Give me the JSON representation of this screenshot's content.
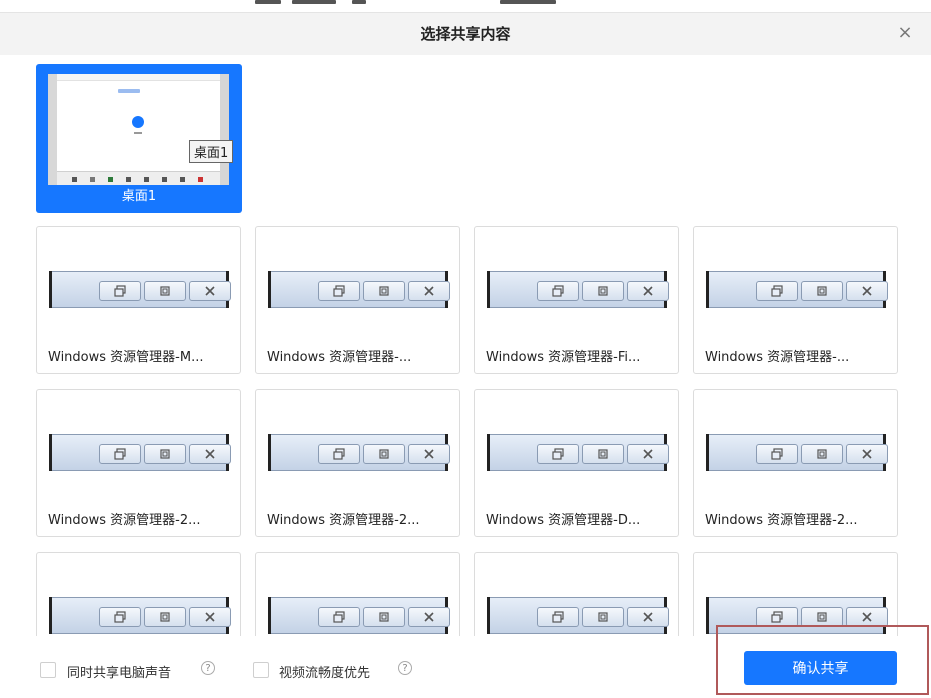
{
  "dialog": {
    "title": "选择共享内容",
    "close_glyph": "×"
  },
  "desktop": {
    "label": "桌面1",
    "tooltip": "桌面1",
    "selected": true,
    "accent_color": "#1677ff"
  },
  "windows": [
    {
      "label": "Windows 资源管理器-M..."
    },
    {
      "label": "Windows 资源管理器-..."
    },
    {
      "label": "Windows 资源管理器-Fi..."
    },
    {
      "label": "Windows 资源管理器-..."
    },
    {
      "label": "Windows 资源管理器-2..."
    },
    {
      "label": "Windows 资源管理器-2..."
    },
    {
      "label": "Windows 资源管理器-D..."
    },
    {
      "label": "Windows 资源管理器-2..."
    },
    {
      "label": ""
    },
    {
      "label": ""
    },
    {
      "label": ""
    },
    {
      "label": ""
    }
  ],
  "thumbnail_buttons": {
    "restore_icon": "restore-icon",
    "maximize_icon": "maximize-icon",
    "close_icon": "close-icon"
  },
  "options": {
    "share_audio_label": "同时共享电脑声音",
    "share_audio_checked": false,
    "video_smooth_label": "视频流畅度优先",
    "video_smooth_checked": false,
    "help_glyph": "?"
  },
  "confirm_button": {
    "label": "确认共享",
    "color": "#1677ff"
  }
}
